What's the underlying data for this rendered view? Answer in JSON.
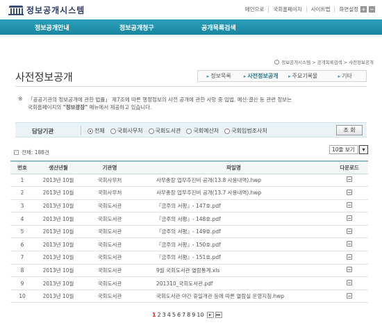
{
  "header": {
    "site_title": "정보공개시스템",
    "links": [
      "메인으로",
      "국회홈페이지",
      "사이트맵",
      "화면설정"
    ]
  },
  "nav": {
    "items": [
      "정보공개안내",
      "정보공개청구",
      "공개목록검색"
    ]
  },
  "breadcrumb": "정보공개시스템 > 공개목록검색 > 사전정보공개",
  "page": {
    "title": "사전정보공개",
    "tabs": [
      {
        "label": "정보목록",
        "active": false
      },
      {
        "label": "사전정보공개",
        "active": true
      },
      {
        "label": "주요기록물",
        "active": false
      },
      {
        "label": "기타",
        "active": false
      }
    ]
  },
  "notice": {
    "mark": "※",
    "line1": "「공공기관의 정보공개에 관한 법률」 제7조에 따른 행정정보의 사전 공개에 관한 사항 중 입법, 예산·결산 등 관련 정보는",
    "line2_pre": "국회홈페이지의 ",
    "line2_bold": "\"정보광장\"",
    "line2_post": " 메뉴에서 제공하고 있습니다."
  },
  "filter": {
    "label": "담당기관",
    "options": [
      {
        "label": "전체",
        "selected": true
      },
      {
        "label": "국회사무처",
        "selected": false
      },
      {
        "label": "국회도서관",
        "selected": false
      },
      {
        "label": "국회예산처",
        "selected": false
      },
      {
        "label": "국회입법조사처",
        "selected": false
      }
    ],
    "search_button": "조 회"
  },
  "list": {
    "total_text": "전체: 188건",
    "page_size": "10줄 보기",
    "columns": [
      "번호",
      "생산년월",
      "기관명",
      "파일명",
      "다운로드"
    ],
    "rows": [
      {
        "no": "1",
        "date": "2013년 10월",
        "org": "국회사무처",
        "file": "사무총장 업무추진비 공개(13.8 사용내역).hwp"
      },
      {
        "no": "2",
        "date": "2013년 10월",
        "org": "국회사무처",
        "file": "사무총장 업무추진비 공개(13.7 사용내역).hwp"
      },
      {
        "no": "3",
        "date": "2013년 10월",
        "org": "국회도서관",
        "file": "『금주의 서평』- 147호.pdf"
      },
      {
        "no": "4",
        "date": "2013년 10월",
        "org": "국회도서관",
        "file": "『금주의 서평』- 148호.pdf"
      },
      {
        "no": "5",
        "date": "2013년 10월",
        "org": "국회도서관",
        "file": "『금주의 서평』- 149호.pdf"
      },
      {
        "no": "6",
        "date": "2013년 10월",
        "org": "국회도서관",
        "file": "『금주의 서평』- 150호.pdf"
      },
      {
        "no": "7",
        "date": "2013년 10월",
        "org": "국회도서관",
        "file": "『금주의 서평』- 151호.pdf"
      },
      {
        "no": "8",
        "date": "2013년 10월",
        "org": "국회도서관",
        "file": "9월 국회도서관 열람통계.xls"
      },
      {
        "no": "9",
        "date": "2013년 10월",
        "org": "국회도서관",
        "file": "201310_국회도서관.pdf"
      },
      {
        "no": "10",
        "date": "2013년 10월",
        "org": "국회도서관",
        "file": "국회도서관 야간 휴일개관 등에 따른 열람실 운영지침.hwp"
      }
    ]
  },
  "pager": {
    "pages": [
      "1",
      "2",
      "3",
      "4",
      "5",
      "6",
      "7",
      "8",
      "9",
      "10"
    ],
    "current": "1",
    "next_icon": "next-page-icon",
    "last_icon": "last-page-icon"
  }
}
